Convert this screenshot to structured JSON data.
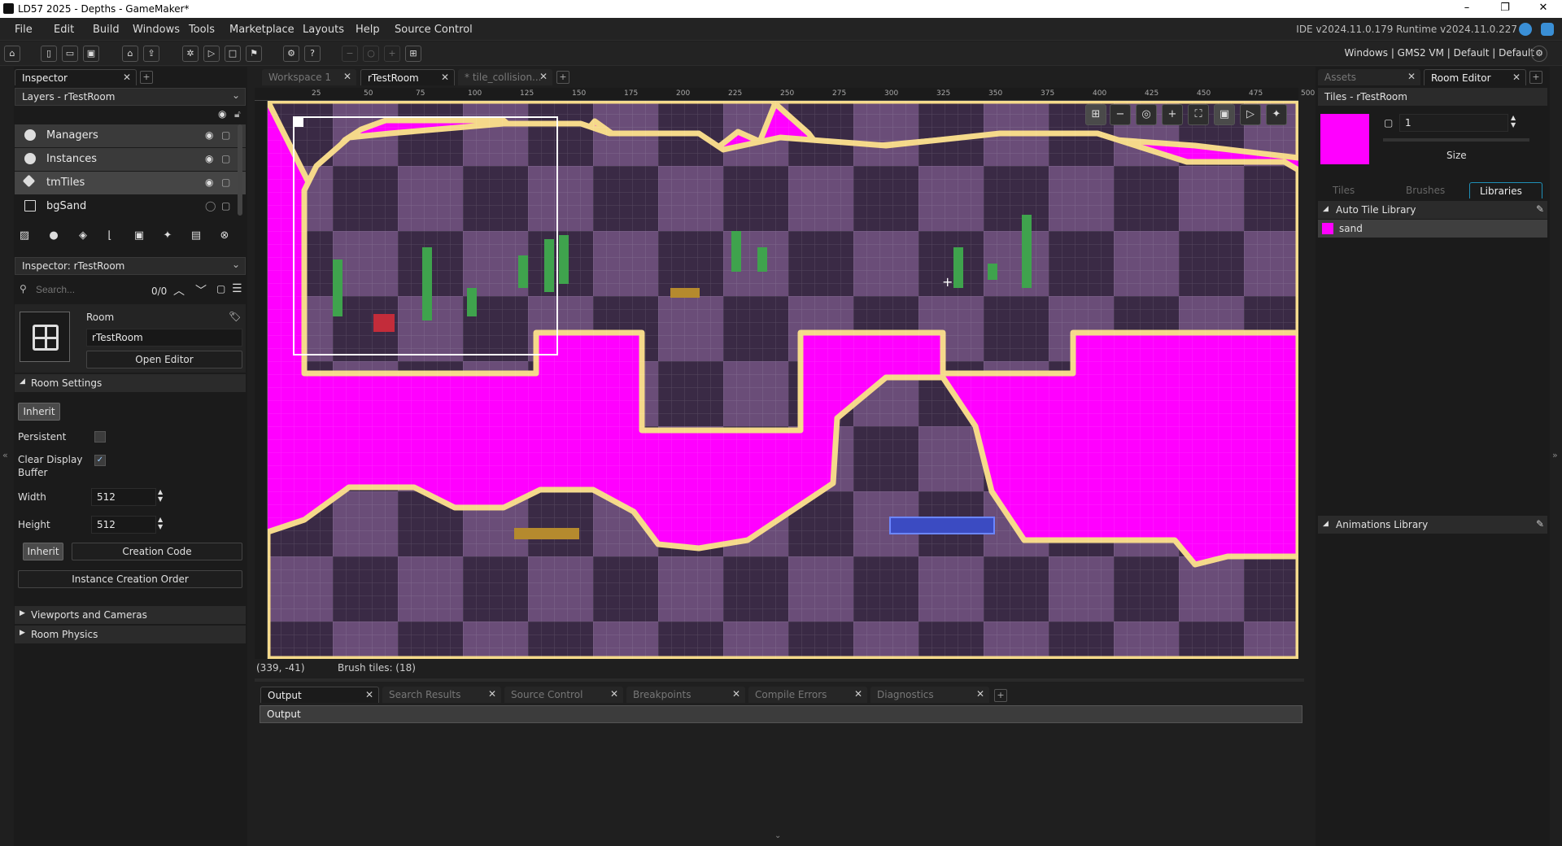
{
  "window": {
    "title": "LD57 2025 - Depths - GameMaker*",
    "minimize": "–",
    "restore": "❐",
    "close": "✕"
  },
  "menu": {
    "items": [
      "File",
      "Edit",
      "Build",
      "Windows",
      "Tools",
      "Marketplace",
      "Layouts",
      "Help",
      "Source Control"
    ],
    "version": "IDE v2024.11.0.179  Runtime v2024.11.0.227"
  },
  "toolbar": {
    "target": "Windows | GMS2 VM | Default | Default"
  },
  "left": {
    "tab_label": "Inspector",
    "layers_header": "Layers - rTestRoom",
    "layers": [
      {
        "name": "Managers",
        "icon": "instance-layer-icon"
      },
      {
        "name": "Instances",
        "icon": "instance-layer-icon"
      },
      {
        "name": "tmTiles",
        "icon": "tile-layer-icon"
      },
      {
        "name": "bgSand",
        "icon": "background-layer-icon"
      }
    ],
    "inspector_header": "Inspector: rTestRoom",
    "search_placeholder": "Search...",
    "search_count": "0/0",
    "room_label": "Room",
    "room_name": "rTestRoom",
    "open_editor": "Open Editor",
    "room_settings": "Room Settings",
    "inherit": "Inherit",
    "persistent": "Persistent",
    "clear_display_1": "Clear Display",
    "clear_display_2": "Buffer",
    "width_label": "Width",
    "width_value": "512",
    "height_label": "Height",
    "height_value": "512",
    "inherit2": "Inherit",
    "creation_code": "Creation Code",
    "instance_creation_order": "Instance Creation Order",
    "viewports": "Viewports and Cameras",
    "room_physics": "Room Physics"
  },
  "center": {
    "tabs": [
      {
        "label": "Workspace 1",
        "active": false
      },
      {
        "label": "rTestRoom",
        "active": true
      },
      {
        "label": "* tile_collision...",
        "active": false
      }
    ],
    "ruler": [
      "25",
      "50",
      "75",
      "100",
      "125",
      "150",
      "175",
      "200",
      "225",
      "250",
      "275",
      "300",
      "325",
      "350",
      "375",
      "400",
      "425",
      "450",
      "475",
      "500"
    ],
    "status_coords": "(339, -41)",
    "status_brush": "Brush tiles: (18)"
  },
  "bottom": {
    "tabs": [
      "Output",
      "Search Results",
      "Source Control",
      "Breakpoints",
      "Compile Errors",
      "Diagnostics"
    ],
    "output_label": "Output"
  },
  "right": {
    "tabs": [
      {
        "label": "Assets",
        "active": false
      },
      {
        "label": "Room Editor",
        "active": true
      }
    ],
    "tiles_header": "Tiles - rTestRoom",
    "brush_size_value": "1",
    "size_label": "Size",
    "subtabs": [
      "Tiles",
      "Brushes",
      "Libraries"
    ],
    "auto_tile_library": "Auto Tile Library",
    "library_item": "sand",
    "animations_library": "Animations Library",
    "swatch_color": "#ff00ff"
  }
}
